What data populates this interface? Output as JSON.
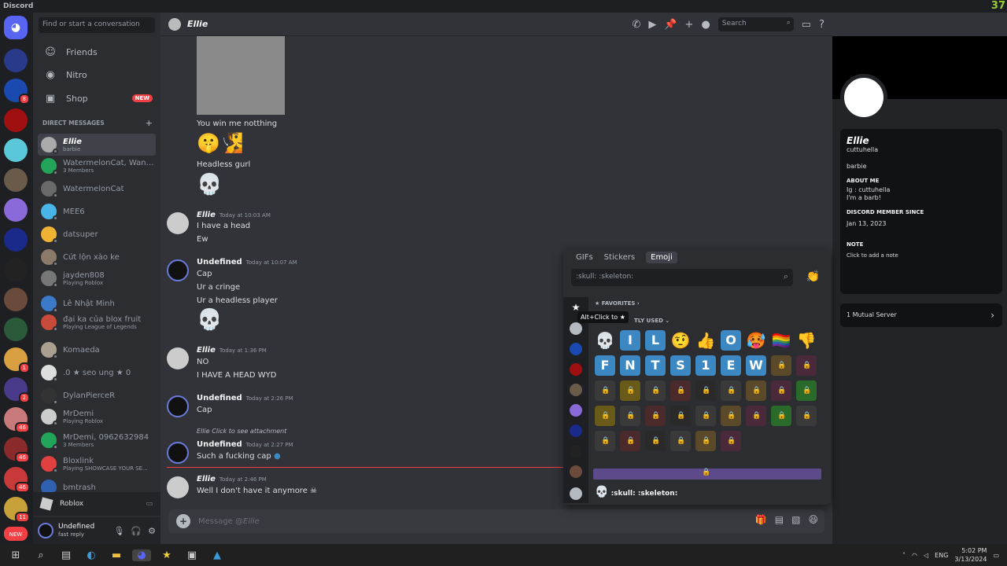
{
  "window": {
    "title": "Discord",
    "overlay_number": "37"
  },
  "dm_search": {
    "placeholder": "Find or start a conversation"
  },
  "nav": [
    {
      "label": "Friends",
      "icon": "friends-icon"
    },
    {
      "label": "Nitro",
      "icon": "nitro-icon"
    },
    {
      "label": "Shop",
      "icon": "shop-icon",
      "badge": "NEW"
    }
  ],
  "dm_header": "DIRECT MESSAGES",
  "dms": [
    {
      "name": "Ellie",
      "sub": "barbie",
      "color": "#aaaaaa"
    },
    {
      "name": "WatermelonCat, Want...",
      "sub": "3 Members",
      "color": "#23a559"
    },
    {
      "name": "WatermelonCat",
      "sub": "",
      "color": "#6a6a6a"
    },
    {
      "name": "MEE6",
      "sub": "",
      "color": "#49b4e8"
    },
    {
      "name": "datsuper",
      "sub": "",
      "color": "#f0b232"
    },
    {
      "name": "Cứt lộn xào ke",
      "sub": "",
      "color": "#8a7a6a"
    },
    {
      "name": "jayden808",
      "sub": "Playing Roblox",
      "color": "#777777"
    },
    {
      "name": "Lê Nhật Minh",
      "sub": "",
      "color": "#3a7ac8"
    },
    {
      "name": "đại ka của blox fruit",
      "sub": "Playing League of Legends",
      "color": "#c84a3a"
    },
    {
      "name": "Komaeda",
      "sub": "",
      "color": "#aaa090"
    },
    {
      "name": ".0 ★ seo ung ★ 0",
      "sub": "",
      "color": "#dddddd"
    },
    {
      "name": "DylanPierceR",
      "sub": "",
      "color": "#333333"
    },
    {
      "name": "MrDemi",
      "sub": "Playing Roblox",
      "color": "#cccccc"
    },
    {
      "name": "MrDemi, 0962632984",
      "sub": "3 Members",
      "color": "#23a559"
    },
    {
      "name": "Bloxlink",
      "sub": "Playing SHOWCASE YOUR SE...",
      "color": "#e04040"
    },
    {
      "name": "bmtrash",
      "sub": "",
      "color": "#3060b0"
    }
  ],
  "activity": {
    "label": "Roblox"
  },
  "user": {
    "name": "Undefined",
    "status": "fast reply"
  },
  "chat_header": {
    "name": "Ellie",
    "search_placeholder": "Search"
  },
  "messages": [
    {
      "lines": [
        "You win me notthing"
      ]
    },
    {
      "lines": [
        "Headless gurl"
      ]
    },
    {
      "author": "Ellie",
      "time": "Today at 10:03 AM",
      "lines": [
        "I have a head",
        "Ew"
      ]
    },
    {
      "author": "Undefined",
      "time": "Today at 10:07 AM",
      "lines": [
        "Cap",
        "Ur a cringe",
        "Ur a headless player"
      ]
    },
    {
      "author": "Ellie",
      "time": "Today at 1:36 PM",
      "lines": [
        "NO",
        "I HAVE A HEAD WYD"
      ]
    },
    {
      "author": "Undefined",
      "time": "Today at 2:26 PM",
      "lines": [
        "Cap"
      ]
    },
    {
      "reply": "Ellie Click to see attachment",
      "author": "Undefined",
      "time": "Today at 2:27 PM",
      "lines": [
        "Such a fucking cap"
      ]
    },
    {
      "author": "Ellie",
      "time": "Today at 2:46 PM",
      "lines": [
        "Well I don't have it anymore"
      ]
    }
  ],
  "composer": {
    "placeholder_prefix": "Message @",
    "placeholder_name": "Ellie"
  },
  "profile": {
    "display_name": "Ellie",
    "username": "cuttuhella",
    "status": "barbie",
    "about_title": "ABOUT ME",
    "about_lines": [
      "Ig : cuttuhella",
      "I'm a barb!"
    ],
    "member_title": "DISCORD MEMBER SINCE",
    "member_date": "Jan 13, 2023",
    "note_title": "NOTE",
    "note_placeholder": "Click to add a note",
    "mutual": "1 Mutual Server"
  },
  "picker": {
    "tabs": [
      "GIFs",
      "Stickers",
      "Emoji"
    ],
    "search_placeholder": ":skull: :skeleton:",
    "favorites": "FAVORITES",
    "recent": "TLY USED",
    "tooltip": "Alt+Click to ★",
    "row1": [
      "💀",
      "I",
      "L",
      "🤨",
      "👍",
      "O",
      "🥵",
      "🏳️‍🌈",
      "👎"
    ],
    "row2": [
      "F",
      "N",
      "T",
      "S",
      "1",
      "E",
      "W"
    ],
    "footer": ":skull: :skeleton:"
  },
  "taskbar": {
    "lang": "ENG",
    "time": "5:02 PM",
    "date": "3/13/2024"
  },
  "colors": {
    "blurple": "#5865f2",
    "red": "#f23f43",
    "green": "#23a559",
    "bg": "#313338"
  }
}
